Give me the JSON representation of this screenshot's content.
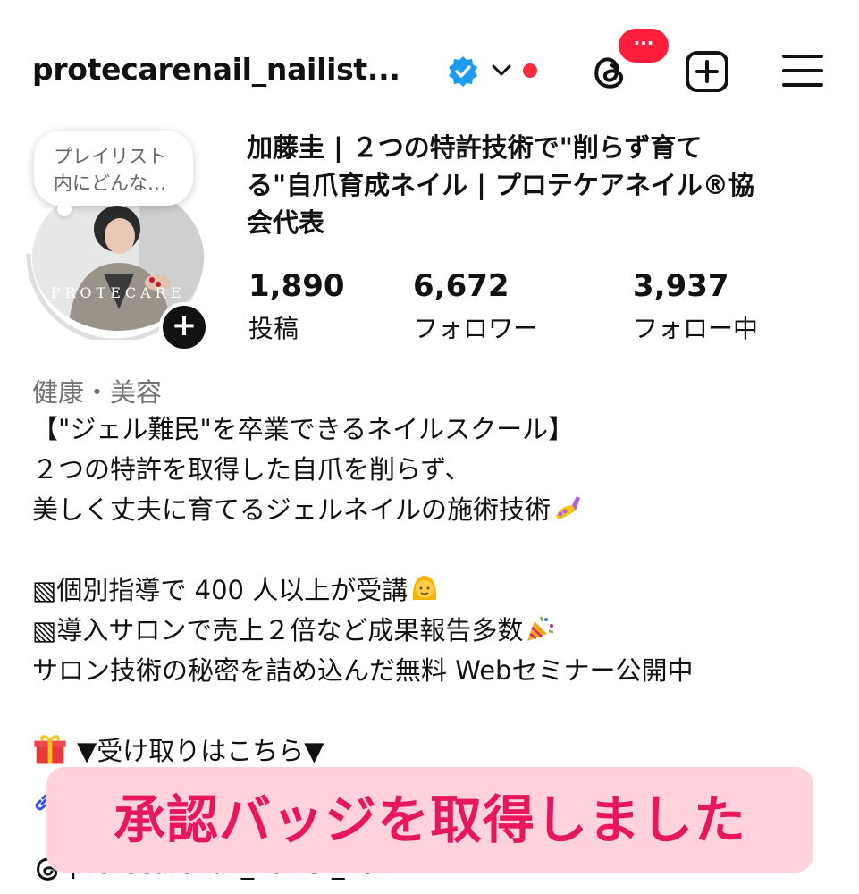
{
  "header": {
    "username": "protecarenail_nailist...",
    "threads_badge": "···"
  },
  "avatar": {
    "bubble_line1": "プレイリスト",
    "bubble_line2": "内にどんな…",
    "watermark": "PROTECARE",
    "add_story_label": "+"
  },
  "profile": {
    "display_name_line1": "加藤圭 | ２つの特許技術で\"削らず育て",
    "display_name_line2": "る\"自爪育成ネイル | プロテケアネイル®協",
    "display_name_line3": "会代表"
  },
  "stats": [
    {
      "value": "1,890",
      "label": "投稿"
    },
    {
      "value": "6,672",
      "label": "フォロワー"
    },
    {
      "value": "3,937",
      "label": "フォロー中"
    }
  ],
  "bio": {
    "category": "健康・美容",
    "lines": [
      "【\"ジェル難民\"を卒業できるネイルスクール】",
      "２つの特許を取得した自爪を削らず、",
      "美しく丈夫に育てるジェルネイルの施術技術",
      "",
      "▧個別指導で 400 人以上が受講",
      "▧導入サロンで売上２倍など成果報告多数",
      "サロン技術の秘密を詰め込んだ無料 Webセミナー公開中",
      "",
      "▼受け取りはこちら▼"
    ],
    "threads_handle": "protecarenail_nailist_kei"
  },
  "overlay": {
    "banner_text": "承認バッジを取得しました"
  },
  "colors": {
    "verified": "#1d9bf0",
    "badge_red": "#ff1e3c",
    "banner_bg": "#ffd2dc",
    "banner_text": "#e8175d",
    "category_gray": "#737373"
  }
}
